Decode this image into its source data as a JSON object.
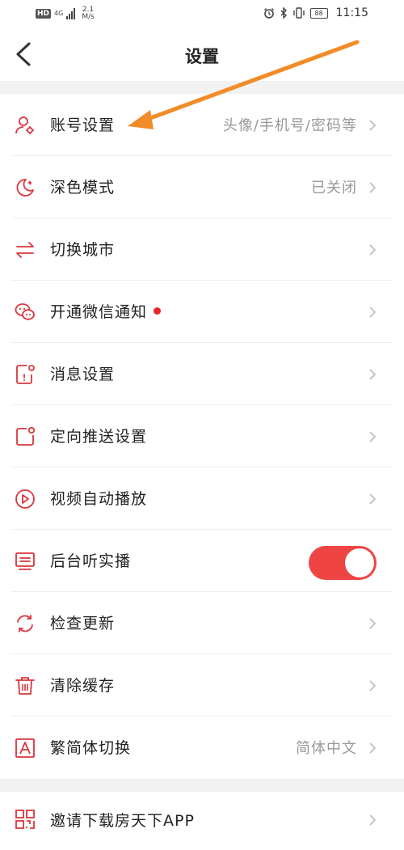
{
  "statusbar": {
    "hd": "HD",
    "network": "4G",
    "speed_value": "2.1",
    "speed_unit": "M/s",
    "battery": "88",
    "time": "11:15"
  },
  "header": {
    "title": "设置"
  },
  "settings": [
    {
      "label": "账号设置",
      "value": "头像/手机号/密码等",
      "icon": "account-gear-icon"
    },
    {
      "label": "深色模式",
      "value": "已关闭",
      "icon": "moon-icon"
    },
    {
      "label": "切换城市",
      "value": "",
      "icon": "swap-arrows-icon"
    },
    {
      "label": "开通微信通知",
      "value": "",
      "icon": "wechat-icon",
      "badge": "red-dot"
    },
    {
      "label": "消息设置",
      "value": "",
      "icon": "message-phone-icon"
    },
    {
      "label": "定向推送设置",
      "value": "",
      "icon": "push-notification-icon"
    },
    {
      "label": "视频自动播放",
      "value": "",
      "icon": "play-circle-icon"
    },
    {
      "label": "后台听实播",
      "value": "",
      "icon": "monitor-icon",
      "toggle": true
    },
    {
      "label": "检查更新",
      "value": "",
      "icon": "refresh-icon"
    },
    {
      "label": "清除缓存",
      "value": "",
      "icon": "trash-icon"
    },
    {
      "label": "繁简体切换",
      "value": "简体中文",
      "icon": "letter-a-icon"
    }
  ],
  "invite": {
    "label": "邀请下载房天下APP",
    "icon": "qrcode-icon"
  },
  "colors": {
    "accent": "#e8262b",
    "toggle_on": "#ef4444",
    "annotation_arrow": "#f28c28"
  }
}
